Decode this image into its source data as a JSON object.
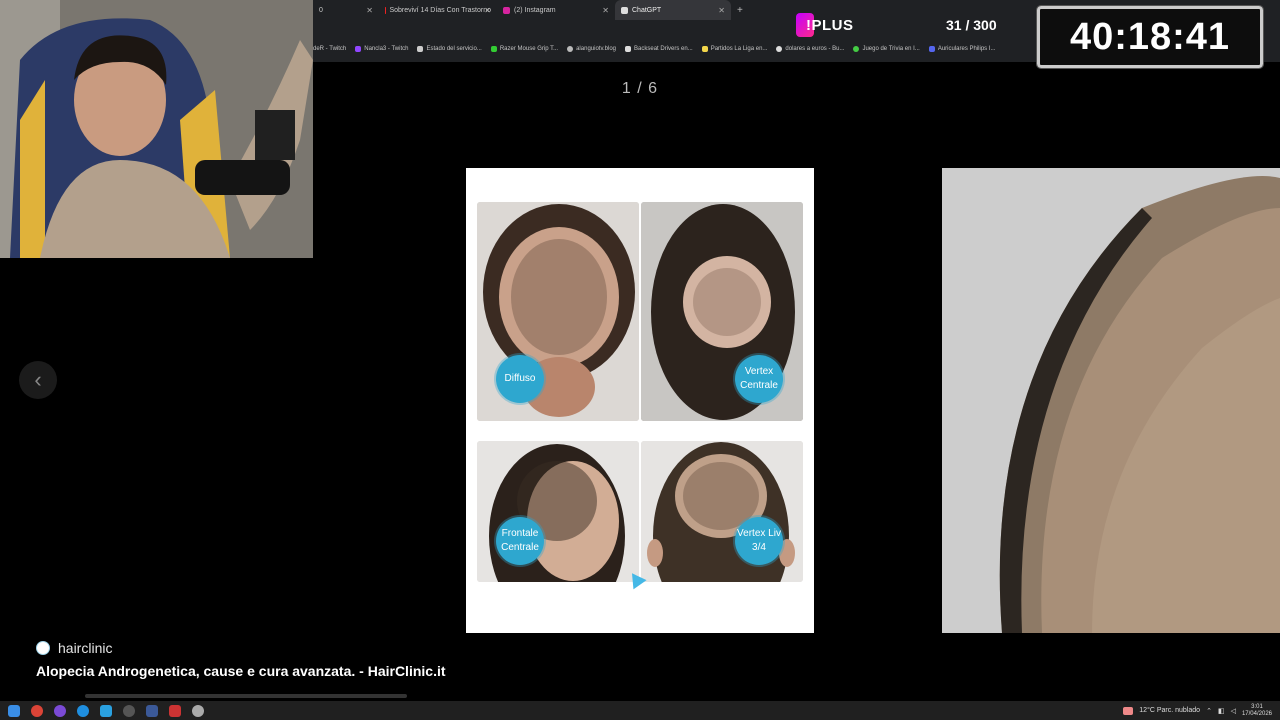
{
  "browser": {
    "tabs": [
      {
        "label": "0",
        "active": false
      },
      {
        "label": "Sobreviví 14 Días Con Trastorno",
        "active": false
      },
      {
        "label": "(2) Instagram",
        "active": false
      },
      {
        "label": "ChatGPT",
        "active": true
      }
    ],
    "bookmarks": [
      "deR - Twitch",
      "Nancla3 - Twitch",
      "Estado del servicio...",
      "Razer Mouse Grip T...",
      "alanguiotv.blog",
      "Backseat Drivers en...",
      "Partidos La Liga en...",
      "dolares a euros - Bu...",
      "Juego de Trivia en I...",
      "Auriculares Philips I..."
    ]
  },
  "overlay": {
    "plus_label": "!PLUS",
    "counter": "31 / 300",
    "timer": "40:18:41"
  },
  "lightbox": {
    "position": "1 / 6",
    "prev_icon": "chevron-left-icon",
    "next_icon": "chevron-right-icon",
    "panels": [
      {
        "label": "Diffuso"
      },
      {
        "label": "Vertex Centrale"
      },
      {
        "label": "Frontale Centrale"
      },
      {
        "label": "Vertex Liv 3/4"
      }
    ],
    "source": "hairclinic",
    "title": "Alopecia Androgenetica, cause e cura avanzata. - HairClinic.it"
  },
  "taskbar": {
    "weather": "12°C  Parc. nublado",
    "time": "3:01",
    "date": "17/04/2026"
  },
  "colors": {
    "badge": "#2ea7cf",
    "plus_gradient_start": "#c400ff",
    "plus_gradient_end": "#ff2a8a"
  }
}
